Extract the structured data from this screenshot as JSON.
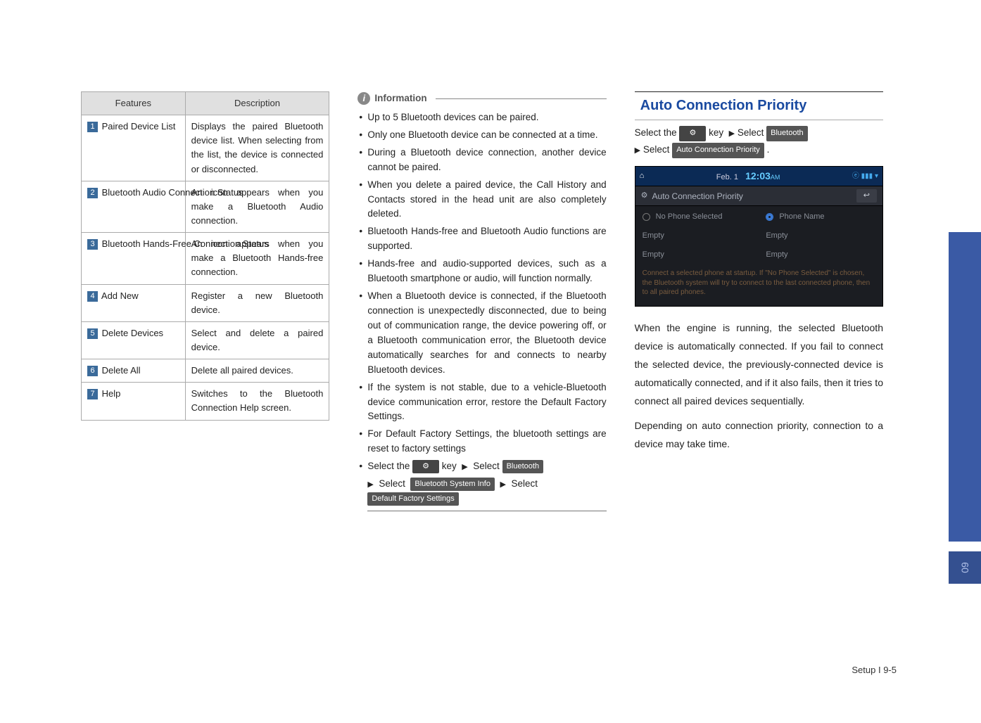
{
  "table": {
    "headers": [
      "Features",
      "Description"
    ],
    "rows": [
      {
        "n": "1",
        "feature": "Paired Device List",
        "desc": "Displays the paired Bluetooth device list. When selecting from the list, the device is connected or disconnected."
      },
      {
        "n": "2",
        "feature": "Bluetooth Audio Connection Status",
        "desc": "An icon appears when you make a Bluetooth Audio connection."
      },
      {
        "n": "3",
        "feature": "Bluetooth Hands-Free Connection Status",
        "desc": "An icon appears when you make a Bluetooth Hands-free connection."
      },
      {
        "n": "4",
        "feature": "Add New",
        "desc": "Register a new Bluetooth device."
      },
      {
        "n": "5",
        "feature": "Delete Devices",
        "desc": "Select and delete a paired device."
      },
      {
        "n": "6",
        "feature": "Delete All",
        "desc": "Delete all paired devices."
      },
      {
        "n": "7",
        "feature": "Help",
        "desc": "Switches to the Bluetooth Connection Help screen."
      }
    ]
  },
  "info": {
    "title": "Information",
    "items": [
      "Up to 5 Bluetooth devices can be paired.",
      "Only one Bluetooth device can be connected at a time.",
      "During a Bluetooth device connection, another device cannot be paired.",
      "When you delete a paired device, the Call History and Contacts stored in the head unit are also completely deleted.",
      "Bluetooth Hands-free and Bluetooth Audio functions are supported.",
      "Hands-free and audio-supported devices, such as a Bluetooth smartphone or audio, will function normally.",
      "When a Bluetooth device is connected, if the Bluetooth connection is unexpectedly disconnected, due to being out of communication range, the device powering off, or a Bluetooth communication error, the Bluetooth device automatically searches for and connects to nearby Bluetooth devices.",
      "If the system is not stable, due to a vehicle-Bluetooth device communication error, restore the Default Factory Settings.",
      "For Default Factory Settings, the bluetooth settings are reset to factory settings"
    ],
    "tail": {
      "prefix": "Select the ",
      "key_label": "key",
      "sel1": "Select",
      "pill_bt": "Bluetooth",
      "sel2": "Select",
      "pill_sys": "Bluetooth System Info",
      "sel3": "Select",
      "pill_def": "Default Factory Settings"
    }
  },
  "col3": {
    "title": "Auto Connection Priority",
    "path": {
      "prefix": "Select the ",
      "key_label": "key",
      "sel1": "Select",
      "pill_bt": "Bluetooth",
      "sel2": "Select",
      "pill_acp": "Auto Connection Priority",
      "dot": "."
    },
    "screen": {
      "date": "Feb.  1",
      "time": "12:03",
      "ampm": "AM",
      "bar_title": "Auto Connection Priority",
      "opt_none": "No Phone Selected",
      "opt_name": "Phone Name",
      "empty": "Empty",
      "hint": "Connect a selected phone at startup. If \"No Phone Selected\" is chosen, the Bluetooth system will try to connect to the last connected phone, then to all paired phones."
    },
    "para1": "When the engine is running, the selected Bluetooth device is automatically connected. If you fail to connect the selected device, the previously-connected device is automatically connected, and if it also fails, then it tries to connect all paired devices sequentially.",
    "para2": "Depending on auto connection priority, connection to a device may take time."
  },
  "side_page": "09",
  "footer": "Setup I 9-5"
}
